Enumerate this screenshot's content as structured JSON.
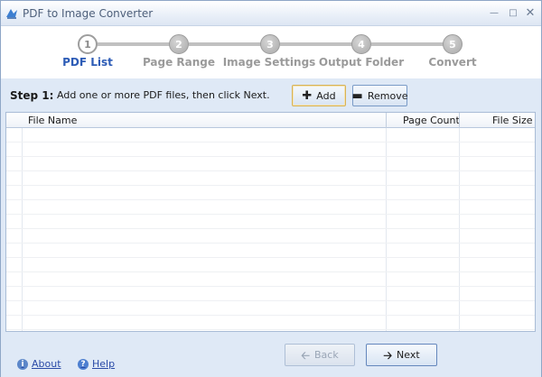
{
  "window": {
    "title": "PDF to Image Converter"
  },
  "steps": [
    {
      "number": "1",
      "label": "PDF List",
      "active": true
    },
    {
      "number": "2",
      "label": "Page Range",
      "active": false
    },
    {
      "number": "3",
      "label": "Image Settings",
      "active": false
    },
    {
      "number": "4",
      "label": "Output Folder",
      "active": false
    },
    {
      "number": "5",
      "label": "Convert",
      "active": false
    }
  ],
  "action": {
    "step_title": "Step 1:",
    "instruction": "Add one or more PDF files, then click Next.",
    "add_label": "Add",
    "remove_label": "Remove"
  },
  "list": {
    "columns": [
      "File Name",
      "Page Count",
      "File Size"
    ],
    "rows": []
  },
  "footer": {
    "about_label": "About",
    "help_label": "Help",
    "back_label": "Back",
    "next_label": "Next"
  },
  "colors": {
    "accent": "#2d5cb6",
    "inactive_step": "#9a9a9a",
    "window_bg": "#dfe9f6"
  }
}
